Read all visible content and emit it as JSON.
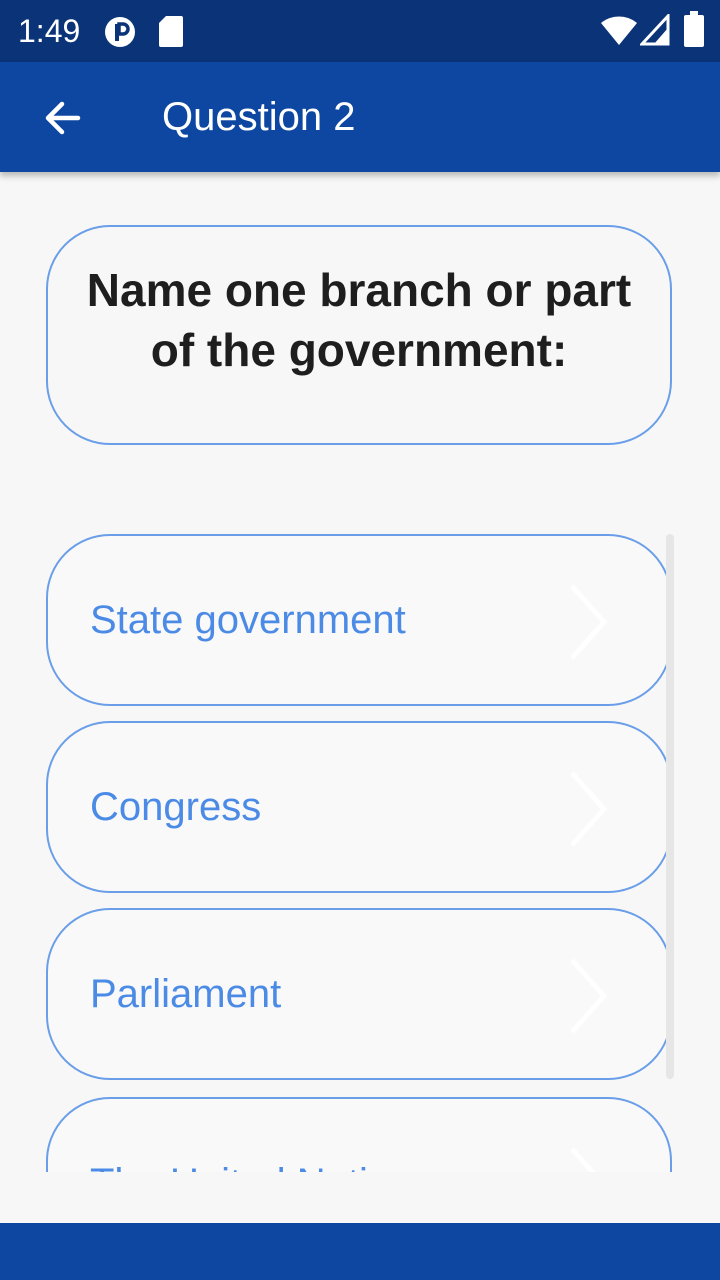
{
  "status_bar": {
    "time": "1:49",
    "icons": [
      "p-badge-icon",
      "sd-card-icon",
      "wifi-icon",
      "signal-icon",
      "battery-icon"
    ]
  },
  "app_bar": {
    "back_icon": "arrow-left-icon",
    "title": "Question 2"
  },
  "question": {
    "text": "Name one branch or part of the government:"
  },
  "answers": [
    {
      "label": "State government"
    },
    {
      "label": "Congress"
    },
    {
      "label": "Parliament"
    },
    {
      "label": "The United Nations"
    }
  ],
  "colors": {
    "status_bar": "#0b3478",
    "app_bar": "#0d47a1",
    "accent_border": "#6a9ee8",
    "answer_text": "#4b8be6",
    "question_text": "#1e1e1e",
    "background": "#f7f7f8"
  }
}
